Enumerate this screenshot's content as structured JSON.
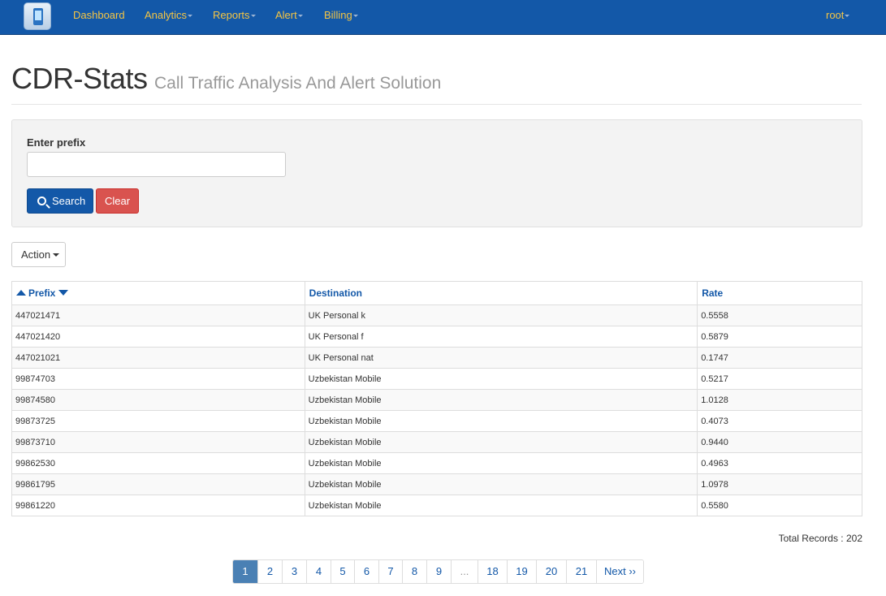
{
  "navbar": {
    "items": [
      {
        "label": "Dashboard",
        "dropdown": false
      },
      {
        "label": "Analytics",
        "dropdown": true
      },
      {
        "label": "Reports",
        "dropdown": true
      },
      {
        "label": "Alert",
        "dropdown": true
      },
      {
        "label": "Billing",
        "dropdown": true
      }
    ],
    "user": "root"
  },
  "header": {
    "title": "CDR-Stats",
    "subtitle": "Call Traffic Analysis And Alert Solution"
  },
  "search": {
    "label": "Enter prefix",
    "value": "",
    "search_button": "Search",
    "clear_button": "Clear"
  },
  "action_button": "Action",
  "table": {
    "columns": [
      "Prefix",
      "Destination",
      "Rate"
    ],
    "rows": [
      [
        "447021471",
        "UK Personal k",
        "0.5558"
      ],
      [
        "447021420",
        "UK Personal f",
        "0.5879"
      ],
      [
        "447021021",
        "UK Personal nat",
        "0.1747"
      ],
      [
        "99874703",
        "Uzbekistan Mobile",
        "0.5217"
      ],
      [
        "99874580",
        "Uzbekistan Mobile",
        "1.0128"
      ],
      [
        "99873725",
        "Uzbekistan Mobile",
        "0.4073"
      ],
      [
        "99873710",
        "Uzbekistan Mobile",
        "0.9440"
      ],
      [
        "99862530",
        "Uzbekistan Mobile",
        "0.4963"
      ],
      [
        "99861795",
        "Uzbekistan Mobile",
        "1.0978"
      ],
      [
        "99861220",
        "Uzbekistan Mobile",
        "0.5580"
      ]
    ]
  },
  "total_records": "Total Records : 202",
  "pagination": {
    "pages": [
      "1",
      "2",
      "3",
      "4",
      "5",
      "6",
      "7",
      "8",
      "9",
      "...",
      "18",
      "19",
      "20",
      "21",
      "Next ››"
    ],
    "active": "1"
  },
  "colors": {
    "navbar": "#1358a8",
    "nav_text": "#f5c543",
    "link": "#1358a8",
    "danger": "#d9534f"
  }
}
